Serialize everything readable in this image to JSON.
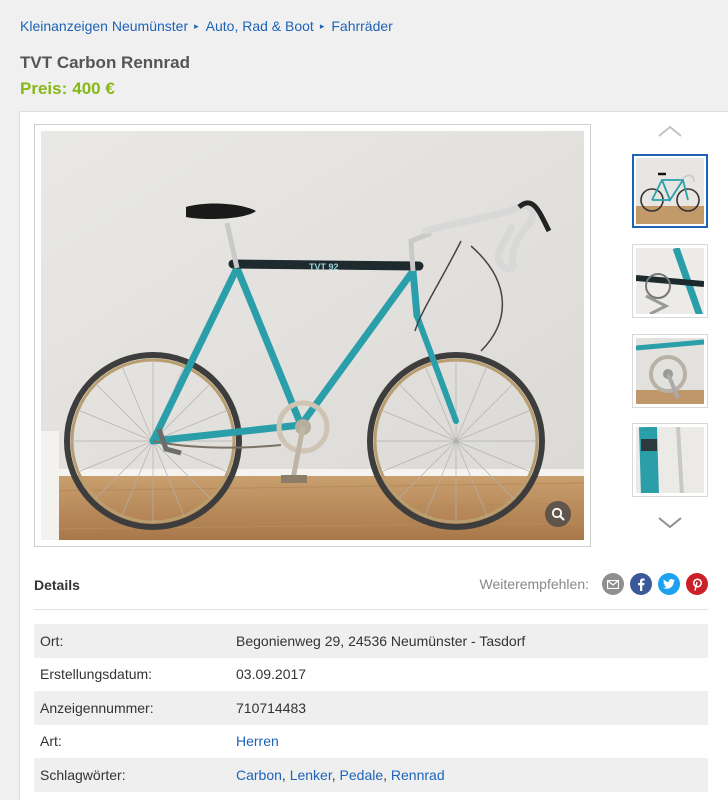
{
  "breadcrumb": {
    "items": [
      "Kleinanzeigen Neumünster",
      "Auto, Rad & Boot",
      "Fahrräder"
    ]
  },
  "listing": {
    "title": "TVT Carbon Rennrad",
    "price_label": "Preis:",
    "price_value": "400 €"
  },
  "gallery": {
    "frame_brand": "TVT 92",
    "thumbnails": 4,
    "active_index": 0
  },
  "details": {
    "heading": "Details",
    "share_label": "Weiterempfehlen:",
    "share_icons": [
      "envelope-icon",
      "facebook-icon",
      "twitter-icon",
      "pinterest-icon"
    ],
    "rows": [
      {
        "key": "Ort:",
        "value": "Begonienweg 29, 24536 Neumünster - Tasdorf"
      },
      {
        "key": "Erstellungsdatum:",
        "value": "03.09.2017"
      },
      {
        "key": "Anzeigennummer:",
        "value": "710714483"
      },
      {
        "key": "Art:",
        "value": "Herren"
      },
      {
        "key": "Schlagwörter:",
        "tags": [
          "Carbon",
          "Lenker",
          "Pedale",
          "Rennrad"
        ]
      }
    ]
  },
  "colors": {
    "link": "#1d63b8",
    "price": "#86b817",
    "email": "#8f8f8f",
    "facebook": "#3b5998",
    "twitter": "#1da1f2",
    "pinterest": "#cb2027"
  }
}
